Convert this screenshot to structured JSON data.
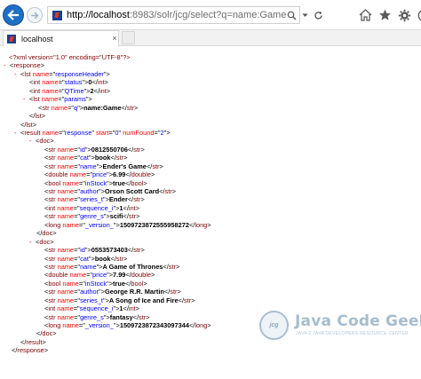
{
  "browser": {
    "url_host": "http://localhost",
    "url_rest": ":8983/solr/jcg/select?q=name:Game",
    "tab_title": "localhost",
    "tab_close": "×",
    "icons": [
      "back-arrow-icon",
      "forward-arrow-icon",
      "search-icon",
      "refresh-icon",
      "home-icon",
      "favorites-star-icon",
      "settings-gear-icon",
      "smiley-icon"
    ]
  },
  "xml": {
    "declaration": "<?xml version=\"1.0\" encoding=\"UTF-8\"?>",
    "toggle": "-",
    "response_tag": "response",
    "lst_tag": "lst",
    "int_tag": "int",
    "str_tag": "str",
    "result_tag": "result",
    "doc_tag": "doc",
    "double_tag": "double",
    "bool_tag": "bool",
    "long_tag": "long",
    "name_attr": "name",
    "start_attr": "start",
    "numfound_attr": "numFound",
    "response_header": {
      "lst_name": "responseHeader",
      "status_name": "status",
      "status_value": "0",
      "qtime_name": "QTime",
      "qtime_value": "2",
      "params_name": "params",
      "q_name": "q",
      "q_value": "name:Game"
    },
    "result": {
      "name": "response",
      "start": "0",
      "num_found": "2"
    },
    "docs": [
      {
        "fields": [
          {
            "tag": "str",
            "name": "id",
            "value": "0812550706"
          },
          {
            "tag": "str",
            "name": "cat",
            "value": "book"
          },
          {
            "tag": "str",
            "name": "name",
            "value": "Ender's Game"
          },
          {
            "tag": "double",
            "name": "price",
            "value": "6.99"
          },
          {
            "tag": "bool",
            "name": "inStock",
            "value": "true"
          },
          {
            "tag": "str",
            "name": "author",
            "value": "Orson Scott Card"
          },
          {
            "tag": "str",
            "name": "series_t",
            "value": "Ender"
          },
          {
            "tag": "int",
            "name": "sequence_i",
            "value": "1"
          },
          {
            "tag": "str",
            "name": "genre_s",
            "value": "scifi"
          },
          {
            "tag": "long",
            "name": "_version_",
            "value": "1509723872555958272"
          }
        ]
      },
      {
        "fields": [
          {
            "tag": "str",
            "name": "id",
            "value": "0553573403"
          },
          {
            "tag": "str",
            "name": "cat",
            "value": "book"
          },
          {
            "tag": "str",
            "name": "name",
            "value": "A Game of Thrones"
          },
          {
            "tag": "double",
            "name": "price",
            "value": "7.99"
          },
          {
            "tag": "bool",
            "name": "inStock",
            "value": "true"
          },
          {
            "tag": "str",
            "name": "author",
            "value": "George R.R. Martin"
          },
          {
            "tag": "str",
            "name": "series_t",
            "value": "A Song of Ice and Fire"
          },
          {
            "tag": "int",
            "name": "sequence_i",
            "value": "1"
          },
          {
            "tag": "str",
            "name": "genre_s",
            "value": "fantasy"
          },
          {
            "tag": "long",
            "name": "_version_",
            "value": "1509723872343097344"
          }
        ]
      }
    ]
  },
  "watermark": {
    "logo_text": "jcg",
    "title": "Java Code Geeks",
    "subtitle": "JAVA 2 JAVA DEVELOPERS RESOURCE CENTER"
  }
}
